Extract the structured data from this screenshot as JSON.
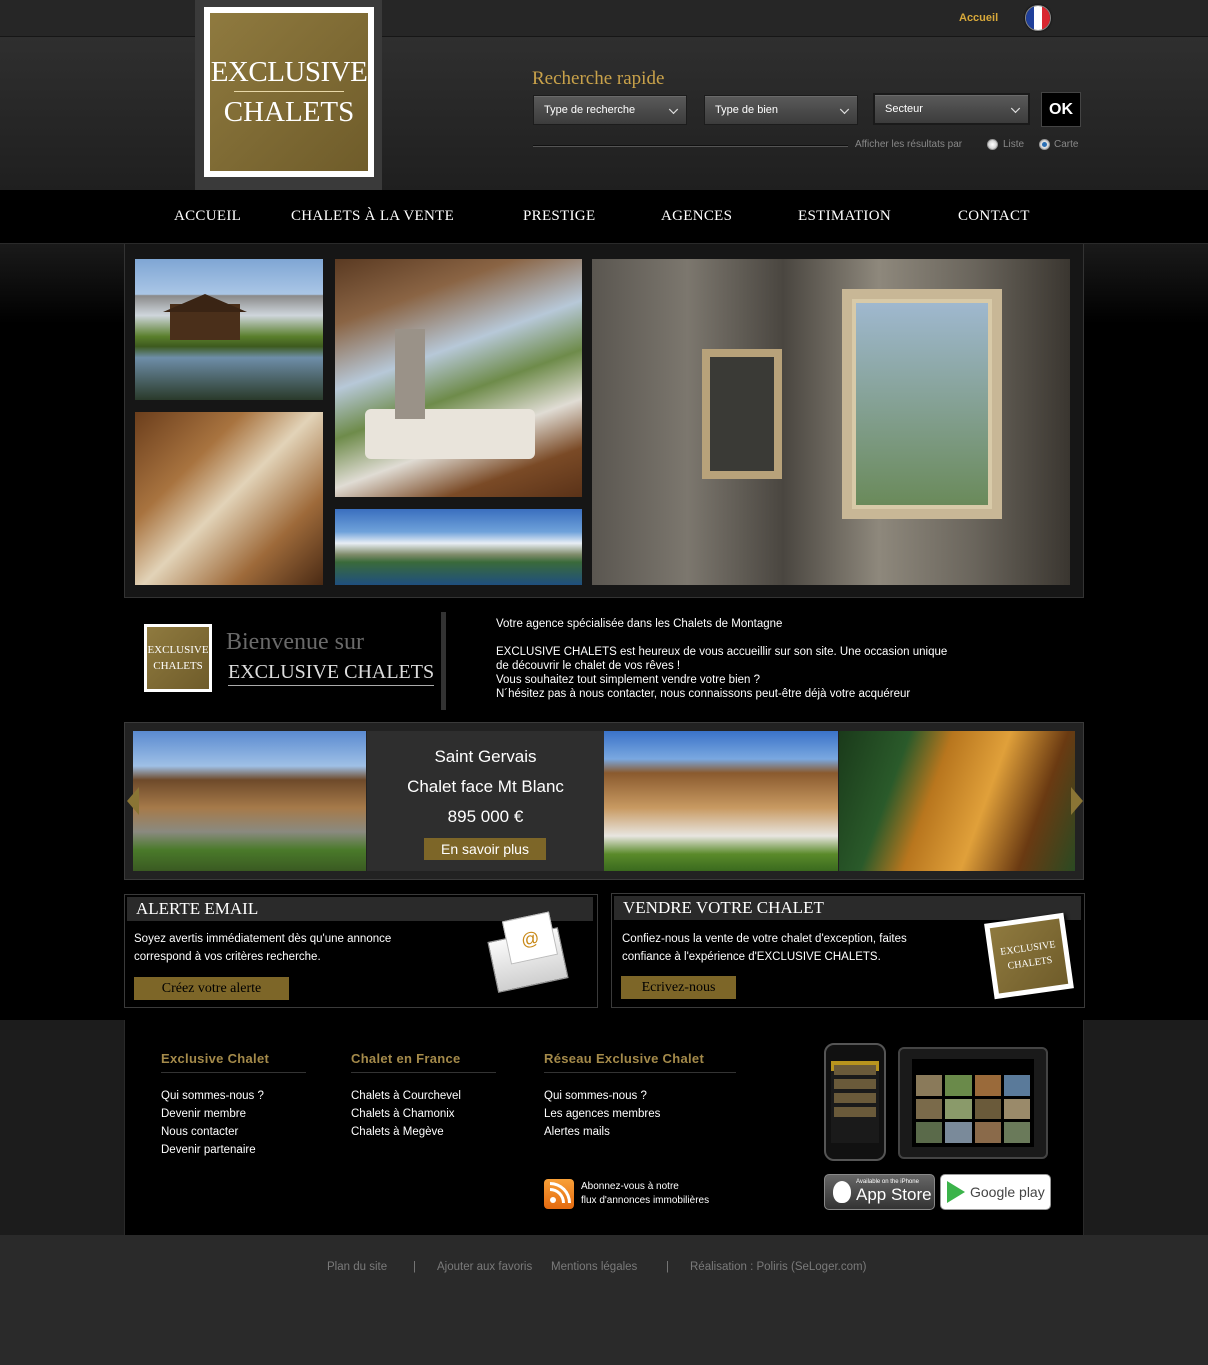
{
  "top": {
    "home_link": "Accueil"
  },
  "logo": {
    "line1": "EXCLUSIVE",
    "line2": "CHALETS"
  },
  "search": {
    "title": "Recherche rapide",
    "type_recherche": "Type de recherche",
    "type_bien": "Type de bien",
    "secteur": "Secteur",
    "ok": "OK",
    "display_label": "Afficher les résultats par",
    "opt_liste": "Liste",
    "opt_carte": "Carte"
  },
  "nav": [
    "ACCUEIL",
    "CHALETS À LA VENTE",
    "PRESTIGE",
    "AGENCES",
    "ESTIMATION",
    "CONTACT"
  ],
  "welcome": {
    "title": "Bienvenue sur",
    "brand": "EXCLUSIVE CHALETS",
    "logo_l1": "EXCLUSIVE",
    "logo_l2": "CHALETS",
    "line1": "Votre agence spécialisée dans les Chalets de Montagne",
    "line2": "EXCLUSIVE CHALETS est heureux de vous accueillir sur son site. Une occasion unique",
    "line3": "de découvrir le chalet de vos rêves !",
    "line4": "Vous souhaitez tout simplement vendre votre bien ?",
    "line5": "N´hésitez pas à nous contacter, nous connaissons peut-être déjà votre acquéreur"
  },
  "carousel": {
    "city": "Saint Gervais",
    "title": "Chalet face Mt Blanc",
    "price": "895 000 €",
    "button": "En savoir plus"
  },
  "alert_box": {
    "title": "ALERTE EMAIL",
    "text1": "Soyez avertis immédiatement dès qu'une annonce",
    "text2": "correspond à vos critères recherche.",
    "button": "Créez votre alerte"
  },
  "sell_box": {
    "title": "VENDRE VOTRE CHALET",
    "text1": "Confiez-nous la vente de votre chalet d'exception, faites",
    "text2": "confiance à l'expérience d'EXCLUSIVE CHALETS.",
    "button": "Ecrivez-nous",
    "badge_l1": "EXCLUSIVE",
    "badge_l2": "CHALETS"
  },
  "footer": {
    "col1": {
      "title": "Exclusive Chalet",
      "links": [
        "Qui sommes-nous ?",
        "Devenir membre",
        "Nous contacter",
        "Devenir partenaire"
      ]
    },
    "col2": {
      "title": "Chalet en France",
      "links": [
        "Chalets à Courchevel",
        "Chalets à Chamonix",
        "Chalets à Megève"
      ]
    },
    "col3": {
      "title": "Réseau Exclusive Chalet",
      "links": [
        "Qui sommes-nous ?",
        "Les agences membres",
        "Alertes mails"
      ]
    },
    "rss_line1": "Abonnez-vous à notre",
    "rss_line2": "flux d'annonces immobilières",
    "appstore_small": "Available on the iPhone",
    "appstore_big": "App Store",
    "googleplay": "Google play"
  },
  "bottom": {
    "plan": "Plan du site",
    "sep": "|",
    "favoris": "Ajouter aux favoris",
    "mentions": "Mentions légales",
    "realisation": "Réalisation : Poliris (SeLoger.com)"
  },
  "colors": {
    "gold": "#7d6628",
    "gold_text": "#c9a24a",
    "link_gold": "#d8a93a"
  }
}
